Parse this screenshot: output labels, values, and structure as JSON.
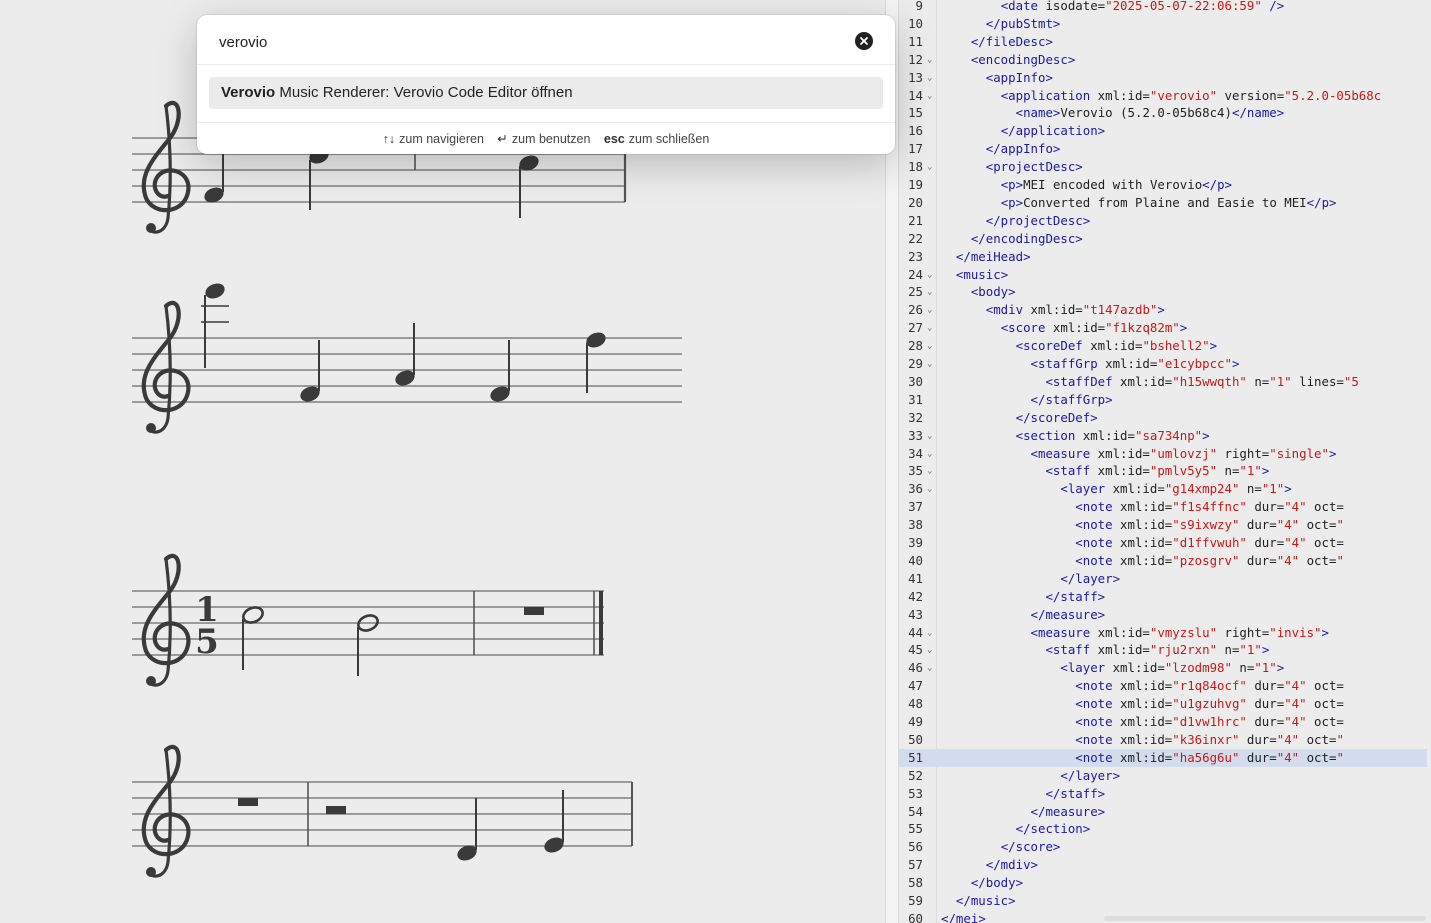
{
  "palette": {
    "query": "verovio",
    "clear_icon": "x-circle-icon",
    "result": {
      "title_bold": "Verovio",
      "title_rest": " Music Renderer: Verovio Code Editor öffnen"
    },
    "hints": [
      {
        "key": "↑↓",
        "label": "zum navigieren"
      },
      {
        "key": "↵",
        "label": "zum benutzen"
      },
      {
        "key": "esc",
        "label": "zum schließen"
      }
    ]
  },
  "score": {
    "systems": [
      {
        "clef": "treble",
        "time_signature": null
      },
      {
        "clef": "treble",
        "time_signature": null
      },
      {
        "clef": "treble",
        "time_signature": {
          "top": "1",
          "bottom": "5"
        }
      },
      {
        "clef": "treble",
        "time_signature": null
      }
    ]
  },
  "editor": {
    "highlighted_line": 51,
    "lines": [
      {
        "n": "9",
        "fold": false,
        "code": "        <date isodate=\"2025-05-07-22:06:59\" />"
      },
      {
        "n": "10",
        "fold": false,
        "code": "      </pubStmt>"
      },
      {
        "n": "11",
        "fold": false,
        "code": "    </fileDesc>"
      },
      {
        "n": "12",
        "fold": true,
        "code": "    <encodingDesc>"
      },
      {
        "n": "13",
        "fold": true,
        "code": "      <appInfo>"
      },
      {
        "n": "14",
        "fold": true,
        "code": "        <application xml:id=\"verovio\" version=\"5.2.0-05b68c"
      },
      {
        "n": "15",
        "fold": false,
        "code": "          <name>Verovio (5.2.0-05b68c4)</name>"
      },
      {
        "n": "16",
        "fold": false,
        "code": "        </application>"
      },
      {
        "n": "17",
        "fold": false,
        "code": "      </appInfo>"
      },
      {
        "n": "18",
        "fold": true,
        "code": "      <projectDesc>"
      },
      {
        "n": "19",
        "fold": false,
        "code": "        <p>MEI encoded with Verovio</p>"
      },
      {
        "n": "20",
        "fold": false,
        "code": "        <p>Converted from Plaine and Easie to MEI</p>"
      },
      {
        "n": "21",
        "fold": false,
        "code": "      </projectDesc>"
      },
      {
        "n": "22",
        "fold": false,
        "code": "    </encodingDesc>"
      },
      {
        "n": "23",
        "fold": false,
        "code": "  </meiHead>"
      },
      {
        "n": "24",
        "fold": true,
        "code": "  <music>"
      },
      {
        "n": "25",
        "fold": true,
        "code": "    <body>"
      },
      {
        "n": "26",
        "fold": true,
        "code": "      <mdiv xml:id=\"t147azdb\">"
      },
      {
        "n": "27",
        "fold": true,
        "code": "        <score xml:id=\"f1kzq82m\">"
      },
      {
        "n": "28",
        "fold": true,
        "code": "          <scoreDef xml:id=\"bshell2\">"
      },
      {
        "n": "29",
        "fold": true,
        "code": "            <staffGrp xml:id=\"e1cybpcc\">"
      },
      {
        "n": "30",
        "fold": false,
        "code": "              <staffDef xml:id=\"h15wwqth\" n=\"1\" lines=\"5"
      },
      {
        "n": "31",
        "fold": false,
        "code": "            </staffGrp>"
      },
      {
        "n": "32",
        "fold": false,
        "code": "          </scoreDef>"
      },
      {
        "n": "33",
        "fold": true,
        "code": "          <section xml:id=\"sa734np\">"
      },
      {
        "n": "34",
        "fold": true,
        "code": "            <measure xml:id=\"umlovzj\" right=\"single\">"
      },
      {
        "n": "35",
        "fold": true,
        "code": "              <staff xml:id=\"pmlv5y5\" n=\"1\">"
      },
      {
        "n": "36",
        "fold": true,
        "code": "                <layer xml:id=\"g14xmp24\" n=\"1\">"
      },
      {
        "n": "37",
        "fold": false,
        "code": "                  <note xml:id=\"f1s4ffnc\" dur=\"4\" oct="
      },
      {
        "n": "38",
        "fold": false,
        "code": "                  <note xml:id=\"s9ixwzy\" dur=\"4\" oct=\""
      },
      {
        "n": "39",
        "fold": false,
        "code": "                  <note xml:id=\"d1ffvwuh\" dur=\"4\" oct="
      },
      {
        "n": "40",
        "fold": false,
        "code": "                  <note xml:id=\"pzosgrv\" dur=\"4\" oct=\""
      },
      {
        "n": "41",
        "fold": false,
        "code": "                </layer>"
      },
      {
        "n": "42",
        "fold": false,
        "code": "              </staff>"
      },
      {
        "n": "43",
        "fold": false,
        "code": "            </measure>"
      },
      {
        "n": "44",
        "fold": true,
        "code": "            <measure xml:id=\"vmyzslu\" right=\"invis\">"
      },
      {
        "n": "45",
        "fold": true,
        "code": "              <staff xml:id=\"rju2rxn\" n=\"1\">"
      },
      {
        "n": "46",
        "fold": true,
        "code": "                <layer xml:id=\"lzodm98\" n=\"1\">"
      },
      {
        "n": "47",
        "fold": false,
        "code": "                  <note xml:id=\"r1q84ocf\" dur=\"4\" oct="
      },
      {
        "n": "48",
        "fold": false,
        "code": "                  <note xml:id=\"u1gzuhvg\" dur=\"4\" oct="
      },
      {
        "n": "49",
        "fold": false,
        "code": "                  <note xml:id=\"d1vw1hrc\" dur=\"4\" oct="
      },
      {
        "n": "50",
        "fold": false,
        "code": "                  <note xml:id=\"k36inxr\" dur=\"4\" oct=\""
      },
      {
        "n": "51",
        "fold": false,
        "code": "                  <note xml:id=\"ha56g6u\" dur=\"4\" oct=\""
      },
      {
        "n": "52",
        "fold": false,
        "code": "                </layer>"
      },
      {
        "n": "53",
        "fold": false,
        "code": "              </staff>"
      },
      {
        "n": "54",
        "fold": false,
        "code": "            </measure>"
      },
      {
        "n": "55",
        "fold": false,
        "code": "          </section>"
      },
      {
        "n": "56",
        "fold": false,
        "code": "        </score>"
      },
      {
        "n": "57",
        "fold": false,
        "code": "      </mdiv>"
      },
      {
        "n": "58",
        "fold": false,
        "code": "    </body>"
      },
      {
        "n": "59",
        "fold": false,
        "code": "  </music>"
      },
      {
        "n": "60",
        "fold": false,
        "code": "</mei>"
      }
    ]
  }
}
